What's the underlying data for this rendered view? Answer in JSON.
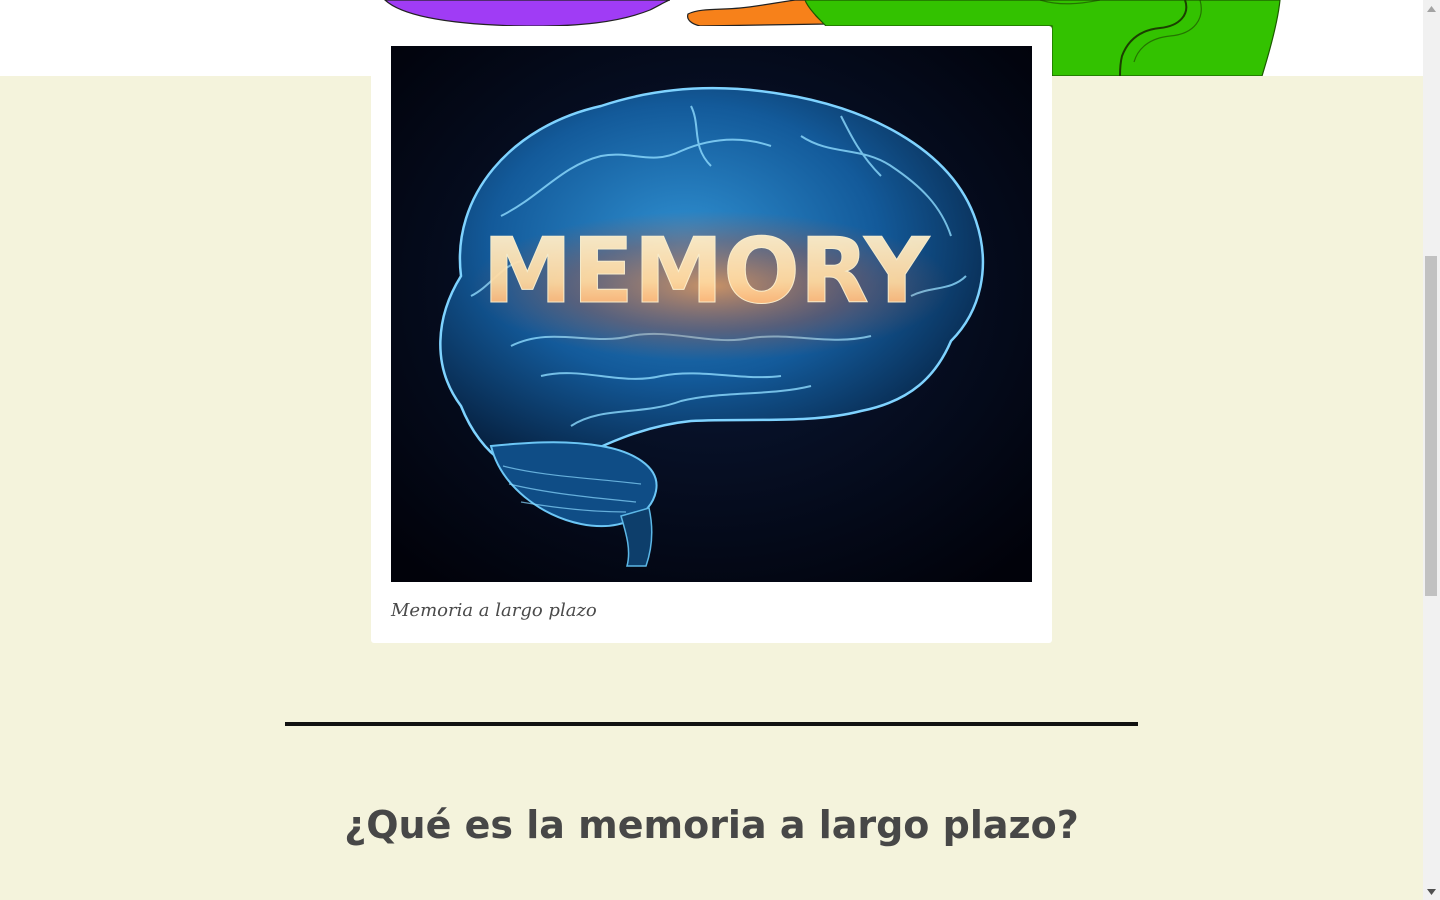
{
  "hero": {
    "puzzle_colors": [
      "#a03cf5",
      "#f7811a",
      "#33c200"
    ]
  },
  "figure": {
    "image_text": "MEMORY",
    "caption": "Memoria a largo plazo"
  },
  "article": {
    "heading": "¿Qué es la memoria a largo plazo?"
  },
  "scrollbar": {
    "up_icon": "triangle-up-icon",
    "down_icon": "triangle-down-icon",
    "scroll_position": 0.41
  },
  "colors": {
    "page_background": "#f4f3dc",
    "heading_color": "#474747",
    "caption_color": "#4a4a4a"
  }
}
